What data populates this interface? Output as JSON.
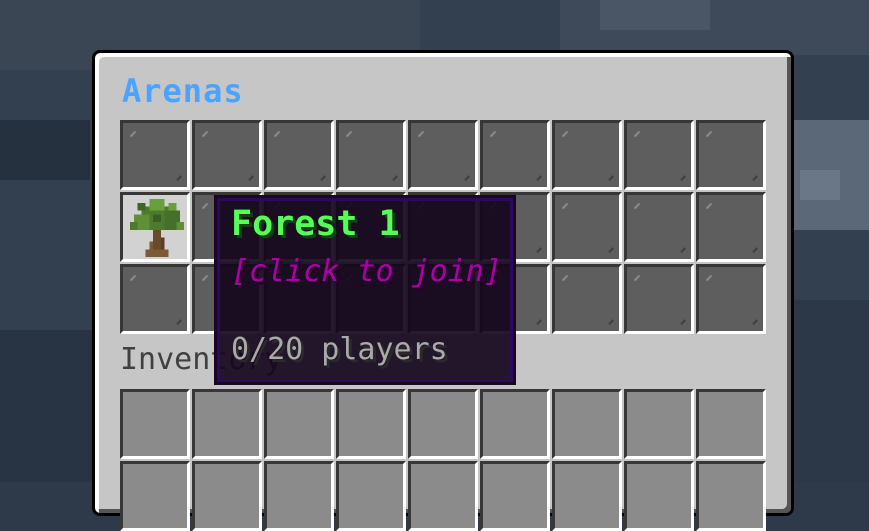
{
  "window": {
    "title": "Arenas",
    "inventory_label": "Inventory"
  },
  "arena_slots": [
    {
      "icon": "oak-tree-icon",
      "name": "Forest 1",
      "action": "[click to join]",
      "players": "0/20 players"
    }
  ],
  "tooltip": {
    "title": "Forest 1",
    "action": "[click to join]",
    "players": "0/20 players"
  },
  "colors": {
    "title": "#4aa3ff",
    "arena_name": "#55ff55",
    "action": "#aa00aa",
    "players": "#aaaaaa",
    "panel": "#c6c6c6",
    "tooltip_bg": "#16061c"
  }
}
